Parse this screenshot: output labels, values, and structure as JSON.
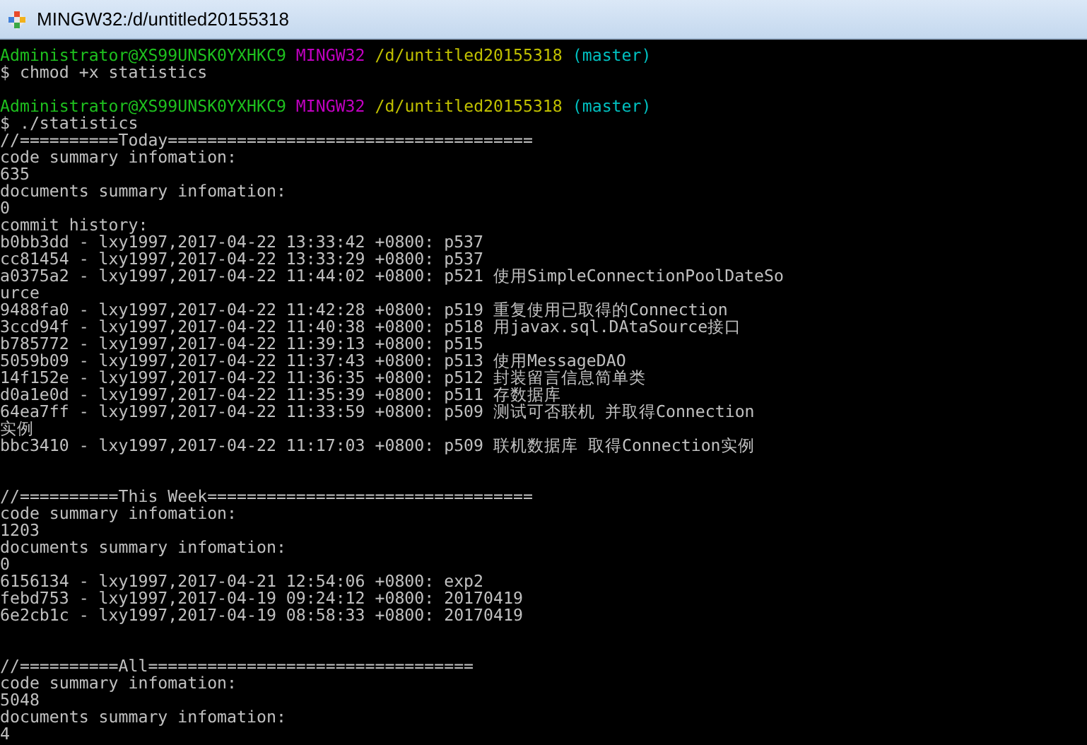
{
  "window": {
    "title": "MINGW32:/d/untitled20155318"
  },
  "terminal": {
    "lines": [
      {
        "kind": "prompt",
        "user": "Administrator@XS99UNSK0YXHKC9",
        "system": "MINGW32",
        "path": "/d/untitled20155318",
        "branch": "(master)"
      },
      {
        "kind": "text",
        "text": "$ chmod +x statistics"
      },
      {
        "kind": "blank"
      },
      {
        "kind": "prompt",
        "user": "Administrator@XS99UNSK0YXHKC9",
        "system": "MINGW32",
        "path": "/d/untitled20155318",
        "branch": "(master)"
      },
      {
        "kind": "text",
        "text": "$ ./statistics"
      },
      {
        "kind": "text",
        "text": "//==========Today====================================="
      },
      {
        "kind": "text",
        "text": "code summary infomation:"
      },
      {
        "kind": "text",
        "text": "635"
      },
      {
        "kind": "text",
        "text": "documents summary infomation:"
      },
      {
        "kind": "text",
        "text": "0"
      },
      {
        "kind": "text",
        "text": "commit history:"
      },
      {
        "kind": "text",
        "text": "b0bb3dd - lxy1997,2017-04-22 13:33:42 +0800: p537"
      },
      {
        "kind": "text",
        "text": "cc81454 - lxy1997,2017-04-22 13:33:29 +0800: p537"
      },
      {
        "kind": "text",
        "text": "a0375a2 - lxy1997,2017-04-22 11:44:02 +0800: p521 使用SimpleConnectionPoolDateSo"
      },
      {
        "kind": "text",
        "text": "urce"
      },
      {
        "kind": "text",
        "text": "9488fa0 - lxy1997,2017-04-22 11:42:28 +0800: p519 重复使用已取得的Connection"
      },
      {
        "kind": "text",
        "text": "3ccd94f - lxy1997,2017-04-22 11:40:38 +0800: p518 用javax.sql.DAtaSource接口"
      },
      {
        "kind": "text",
        "text": "b785772 - lxy1997,2017-04-22 11:39:13 +0800: p515"
      },
      {
        "kind": "text",
        "text": "5059b09 - lxy1997,2017-04-22 11:37:43 +0800: p513 使用MessageDAO"
      },
      {
        "kind": "text",
        "text": "14f152e - lxy1997,2017-04-22 11:36:35 +0800: p512 封装留言信息简单类"
      },
      {
        "kind": "text",
        "text": "d0a1e0d - lxy1997,2017-04-22 11:35:39 +0800: p511 存数据库"
      },
      {
        "kind": "text",
        "text": "64ea7ff - lxy1997,2017-04-22 11:33:59 +0800: p509 测试可否联机 并取得Connection"
      },
      {
        "kind": "text",
        "text": "实例"
      },
      {
        "kind": "text",
        "text": "bbc3410 - lxy1997,2017-04-22 11:17:03 +0800: p509 联机数据库 取得Connection实例"
      },
      {
        "kind": "blank"
      },
      {
        "kind": "blank"
      },
      {
        "kind": "text",
        "text": "//==========This Week================================="
      },
      {
        "kind": "text",
        "text": "code summary infomation:"
      },
      {
        "kind": "text",
        "text": "1203"
      },
      {
        "kind": "text",
        "text": "documents summary infomation:"
      },
      {
        "kind": "text",
        "text": "0"
      },
      {
        "kind": "text",
        "text": "6156134 - lxy1997,2017-04-21 12:54:06 +0800: exp2"
      },
      {
        "kind": "text",
        "text": "febd753 - lxy1997,2017-04-19 09:24:12 +0800: 20170419"
      },
      {
        "kind": "text",
        "text": "6e2cb1c - lxy1997,2017-04-19 08:58:33 +0800: 20170419"
      },
      {
        "kind": "blank"
      },
      {
        "kind": "blank"
      },
      {
        "kind": "text",
        "text": "//==========All================================="
      },
      {
        "kind": "text",
        "text": "code summary infomation:"
      },
      {
        "kind": "text",
        "text": "5048"
      },
      {
        "kind": "text",
        "text": "documents summary infomation:"
      },
      {
        "kind": "text",
        "text": "4"
      }
    ]
  }
}
